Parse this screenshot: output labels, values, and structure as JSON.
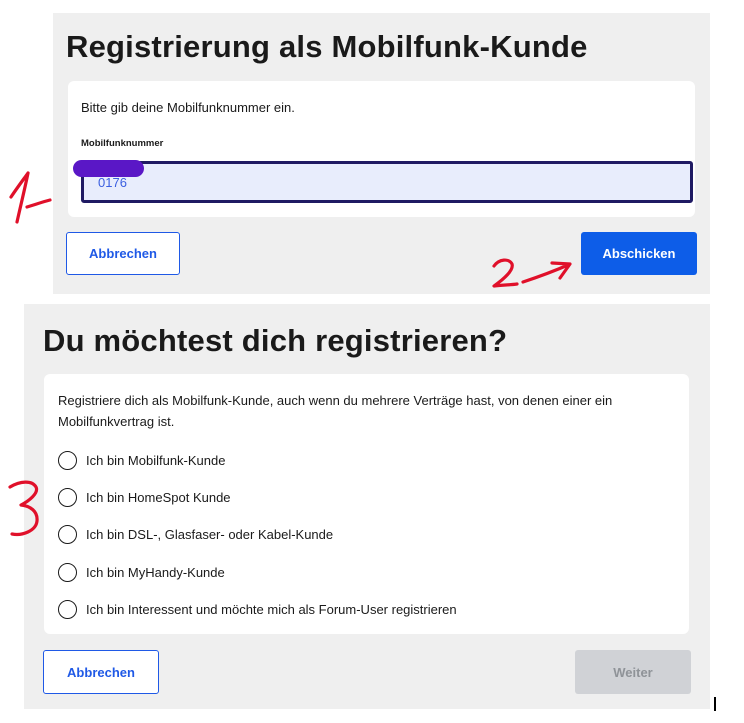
{
  "registration": {
    "title": "Registrierung als Mobilfunk-Kunde",
    "intro": "Bitte gib deine Mobilfunknummer ein.",
    "field_label": "Mobilfunknummer",
    "phone_value": "0176",
    "cancel_label": "Abbrechen",
    "submit_label": "Abschicken"
  },
  "customer_type": {
    "title": "Du möchtest dich registrieren?",
    "intro": "Registriere dich als Mobilfunk-Kunde, auch wenn du mehrere Verträge hast, von denen einer ein Mobilfunkvertrag ist.",
    "options": [
      "Ich bin Mobilfunk-Kunde",
      "Ich bin HomeSpot Kunde",
      "Ich bin DSL-, Glasfaser- oder Kabel-Kunde",
      "Ich bin MyHandy-Kunde",
      "Ich bin Interessent und möchte mich als Forum-User registrieren"
    ],
    "cancel_label": "Abbrechen",
    "next_label": "Weiter"
  },
  "colors": {
    "primary": "#0d5de8",
    "input_border": "#1f1a63",
    "redaction": "#5a17c6",
    "annotation": "#e0102a"
  }
}
